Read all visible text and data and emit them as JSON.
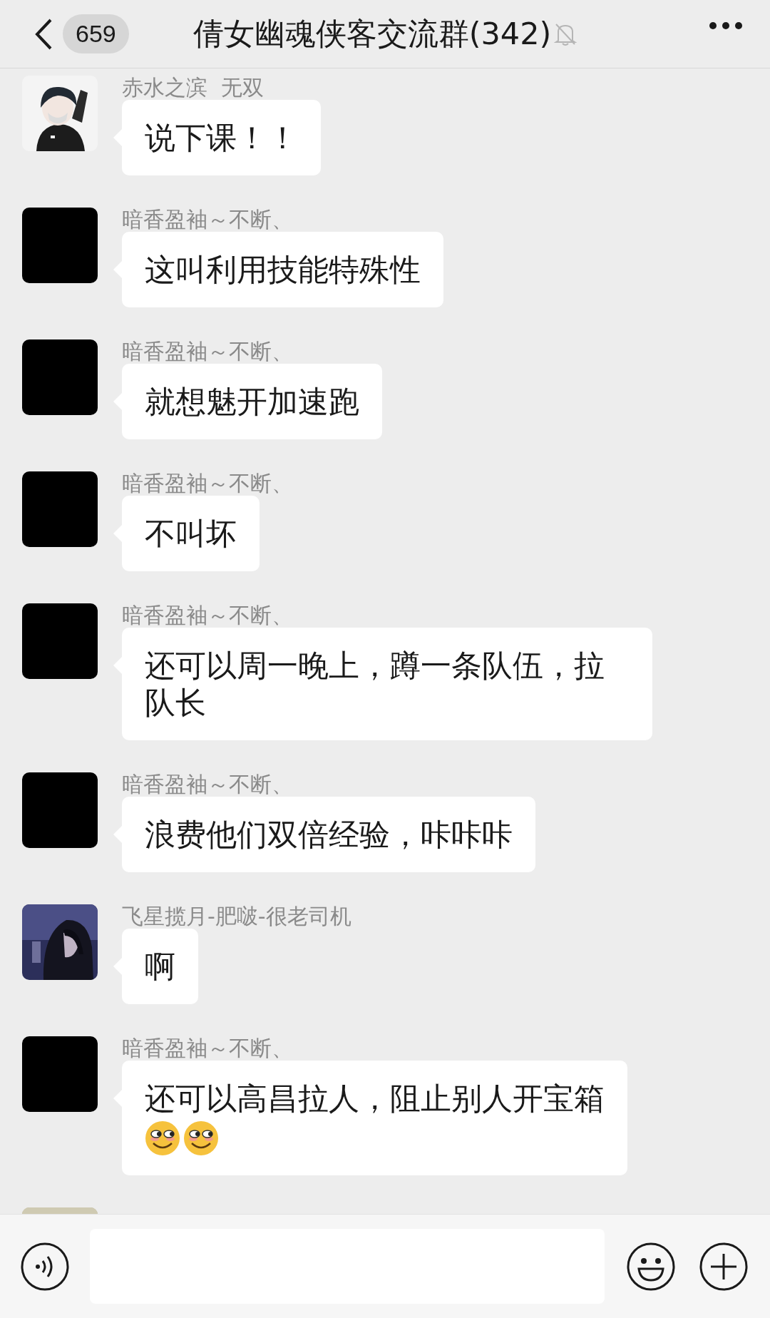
{
  "header": {
    "back_count": "659",
    "title": "倩女幽魂侠客交流群(342)",
    "muted": true
  },
  "messages": [
    {
      "sender": "赤水之滨  无双",
      "avatar": {
        "kind": "picture"
      },
      "text": "说下课！！"
    },
    {
      "sender": "暗香盈袖～不断、",
      "avatar": {
        "kind": "blank"
      },
      "text": "这叫利用技能特殊性"
    },
    {
      "sender": "暗香盈袖～不断、",
      "avatar": {
        "kind": "blank"
      },
      "text": "就想魅开加速跑"
    },
    {
      "sender": "暗香盈袖～不断、",
      "avatar": {
        "kind": "blank"
      },
      "text": "不叫坏"
    },
    {
      "sender": "暗香盈袖～不断、",
      "avatar": {
        "kind": "blank"
      },
      "text": "还可以周一晚上，蹲一条队伍，拉队长"
    },
    {
      "sender": "暗香盈袖～不断、",
      "avatar": {
        "kind": "blank"
      },
      "text": "浪费他们双倍经验，咔咔咔"
    },
    {
      "sender": "飞星揽月-肥啵-很老司机",
      "avatar": {
        "kind": "picture"
      },
      "text": "啊"
    },
    {
      "sender": "暗香盈袖～不断、",
      "avatar": {
        "kind": "blank"
      },
      "text": "还可以高昌拉人，阻止别人开宝箱",
      "emojis": [
        {
          "kind": "smirk"
        },
        {
          "kind": "smirk"
        }
      ]
    },
    {
      "avatar": {
        "kind": "picture"
      }
    }
  ]
}
